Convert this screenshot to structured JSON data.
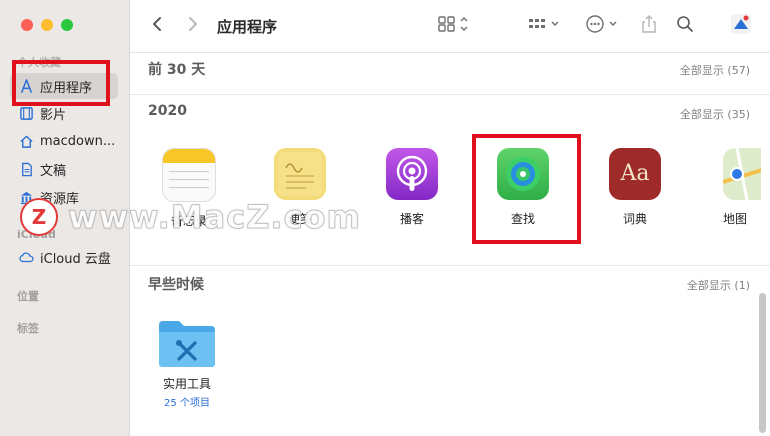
{
  "sidebar": {
    "section_favorites": "个人收藏",
    "items": [
      {
        "label": "应用程序",
        "icon": "app-store-icon"
      },
      {
        "label": "影片",
        "icon": "film-icon"
      },
      {
        "label": "macdown...",
        "icon": "home-icon"
      },
      {
        "label": "文稿",
        "icon": "document-icon"
      },
      {
        "label": "资源库",
        "icon": "building-icon"
      }
    ],
    "section_icloud": "iCloud",
    "icloud_items": [
      {
        "label": "iCloud 云盘",
        "icon": "cloud-icon"
      }
    ],
    "section_locations": "位置",
    "section_tags": "标签"
  },
  "toolbar": {
    "title": "应用程序"
  },
  "groups": [
    {
      "title": "前 30 天",
      "show_all": "全部显示 (57)"
    },
    {
      "title": "2020",
      "show_all": "全部显示 (35)",
      "apps": [
        {
          "name": "备忘录"
        },
        {
          "name": "便笺"
        },
        {
          "name": "播客"
        },
        {
          "name": "查找"
        },
        {
          "name": "词典"
        },
        {
          "name": "地图"
        }
      ]
    },
    {
      "title": "早些时候",
      "show_all": "全部显示 (1)",
      "folders": [
        {
          "name": "实用工具",
          "subtitle": "25 个项目"
        }
      ]
    }
  ],
  "watermark": {
    "text": "www.MacZ.com",
    "logo": "Z"
  },
  "colors": {
    "highlight": "#e0101c",
    "accent": "#2a6fd6"
  }
}
